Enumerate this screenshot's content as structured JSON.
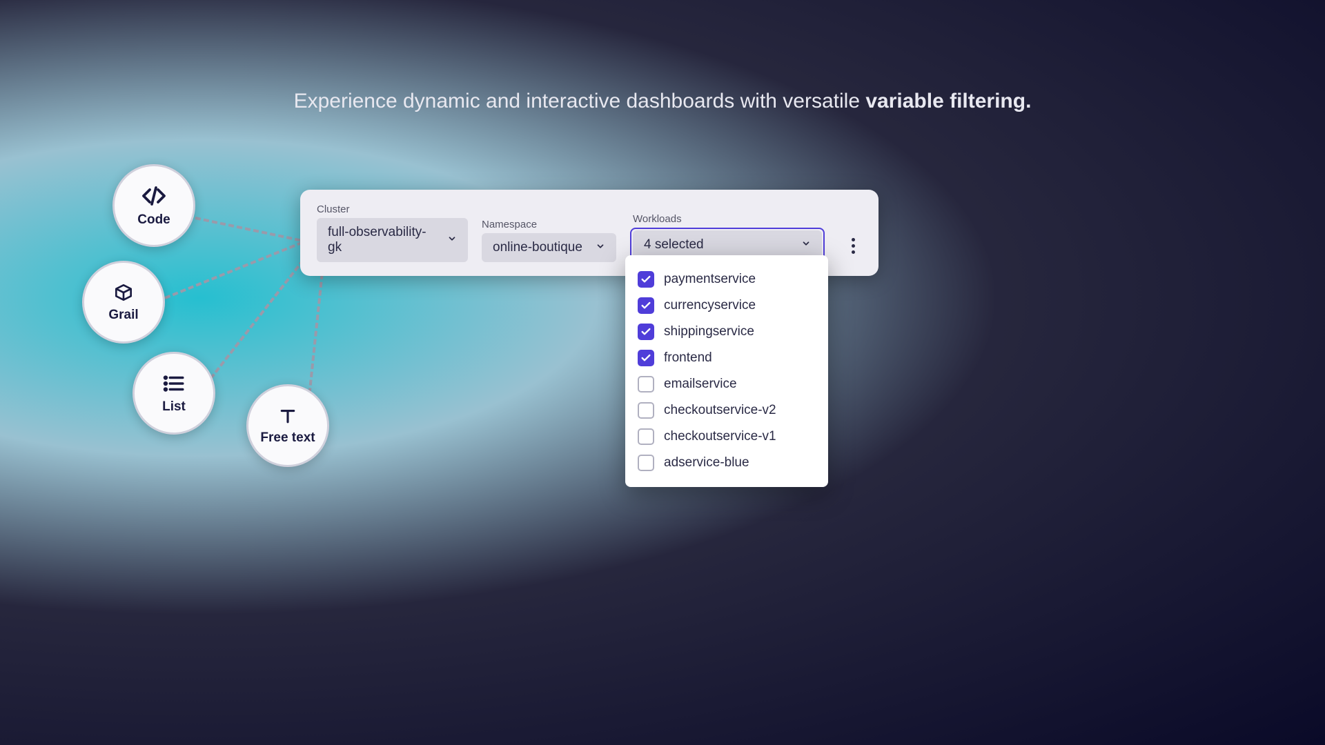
{
  "headline": {
    "prefix": "Experience dynamic and interactive dashboards with versatile ",
    "bold": "variable filtering."
  },
  "nodes": {
    "code": "Code",
    "grail": "Grail",
    "list": "List",
    "freetext": "Free text"
  },
  "filters": {
    "cluster": {
      "label": "Cluster",
      "value": "full-observability-gk"
    },
    "namespace": {
      "label": "Namespace",
      "value": "online-boutique"
    },
    "workloads": {
      "label": "Workloads",
      "value": "4 selected",
      "options": [
        {
          "label": "paymentservice",
          "checked": true
        },
        {
          "label": "currencyservice",
          "checked": true
        },
        {
          "label": "shippingservice",
          "checked": true
        },
        {
          "label": "frontend",
          "checked": true
        },
        {
          "label": "emailservice",
          "checked": false
        },
        {
          "label": "checkoutservice-v2",
          "checked": false
        },
        {
          "label": "checkoutservice-v1",
          "checked": false
        },
        {
          "label": "adservice-blue",
          "checked": false
        }
      ]
    }
  }
}
